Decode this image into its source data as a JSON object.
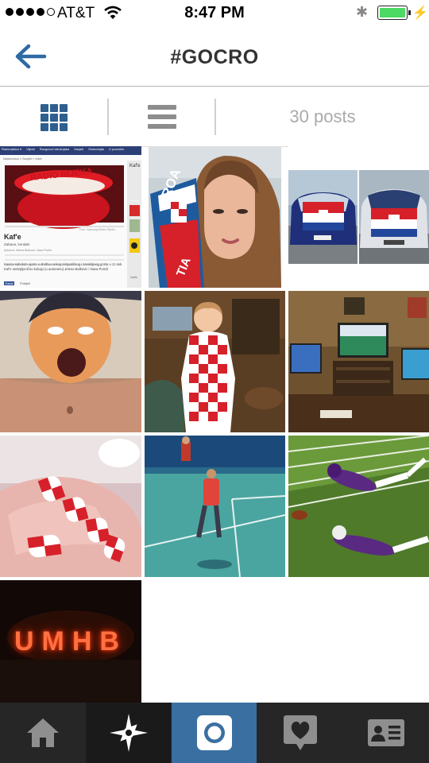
{
  "status_bar": {
    "carrier": "AT&T",
    "time": "8:47 PM"
  },
  "header": {
    "title": "#GOCRO",
    "back_icon": "back-arrow-icon"
  },
  "view_toggle": {
    "grid_icon": "grid-view-icon",
    "list_icon": "list-view-icon",
    "posts_count": "30 posts"
  },
  "photos": {
    "p1": {
      "nav": [
        "Računalstvo ▾",
        "Vijesti",
        "Razgovori stručnjaka",
        "Savjeti",
        "Slobodnjak",
        "U pozadini"
      ],
      "crumbs": "Naslovnica » Savjeti » Kafe",
      "cup_label": "RADIO RIJEKA",
      "side_label": "Kaf'e",
      "caption": "Foto: Ilustracija/Radio Rijeka",
      "heading": "Kaf'e",
      "sub": "Zabava, kontakt",
      "meta": "Autorica: Jelena Bulkovic, Nava Purich",
      "body": "Kavica subotom ujutro u društvu nekog simpatičnog i zanimljivog gosta u 11 sati. Kaf'e nestrpljenično kuhaju (u autoramu) Jelena Bulkovic i Nava Purich",
      "tag1": "Kava",
      "tag2": "Podijeli",
      "side1": "HRVA",
      "side2": "radio"
    },
    "p2": {
      "scarf_text": "CROA",
      "scarf_text2": "TIA"
    },
    "p10": {
      "sign": "UMHB"
    }
  },
  "tab_bar": {
    "items": [
      {
        "icon": "home-icon"
      },
      {
        "icon": "explore-star-icon"
      },
      {
        "icon": "camera-icon"
      },
      {
        "icon": "activity-heart-icon"
      },
      {
        "icon": "profile-card-icon"
      }
    ]
  },
  "colors": {
    "accent": "#2e5f8f",
    "tab_bar_bg": "#262626",
    "tab_active": "#3a6fa1",
    "croatia_red": "#d0202a"
  }
}
